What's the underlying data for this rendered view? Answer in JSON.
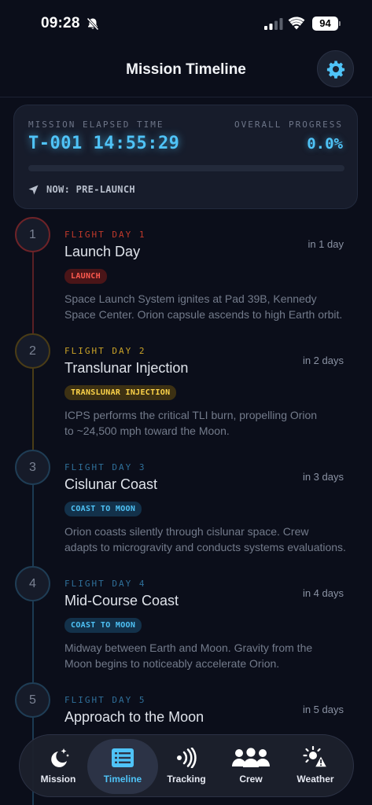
{
  "status_bar": {
    "time": "09:28",
    "battery": "94"
  },
  "header": {
    "title": "Mission Timeline",
    "settings_icon": "gear-icon"
  },
  "mission": {
    "elapsed_label": "MISSION ELAPSED TIME",
    "elapsed_value": "T-001 14:55:29",
    "progress_label": "OVERALL PROGRESS",
    "progress_value": "0.0%",
    "progress_fraction": 0.0,
    "now_text": "NOW: PRE-LAUNCH"
  },
  "events": [
    {
      "number": "1",
      "flight_day": "FLIGHT DAY 1",
      "title": "Launch Day",
      "when": "in 1 day",
      "badge": "LAUNCH",
      "desc_line1": "Space Launch System ignites at Pad 39B, Kennedy",
      "desc_line2": "Space Center. Orion capsule ascends to high Earth orbit.",
      "accent": "#c0392b",
      "badge_bg": "#4a1518",
      "badge_fg": "#ff5a4f"
    },
    {
      "number": "2",
      "flight_day": "FLIGHT DAY 2",
      "title": "Translunar Injection",
      "when": "in 2 days",
      "badge": "TRANSLUNAR INJECTION",
      "desc_line1": "ICPS performs the critical TLI burn, propelling Orion",
      "desc_line2": "to ~24,500 mph toward the Moon.",
      "accent": "#c9a227",
      "badge_bg": "#3d3113",
      "badge_fg": "#ffd54a"
    },
    {
      "number": "3",
      "flight_day": "FLIGHT DAY 3",
      "title": "Cislunar Coast",
      "when": "in 3 days",
      "badge": "COAST TO MOON",
      "desc_line1": "Orion coasts silently through cislunar space. Crew",
      "desc_line2": "adapts to microgravity and conducts systems evaluations.",
      "accent": "#2f6f99",
      "badge_bg": "#13314a",
      "badge_fg": "#4fc3f7"
    },
    {
      "number": "4",
      "flight_day": "FLIGHT DAY 4",
      "title": "Mid-Course Coast",
      "when": "in 4 days",
      "badge": "COAST TO MOON",
      "desc_line1": "Midway between Earth and Moon. Gravity from the",
      "desc_line2": "Moon begins to noticeably accelerate Orion.",
      "accent": "#2f6f99",
      "badge_bg": "#13314a",
      "badge_fg": "#4fc3f7"
    },
    {
      "number": "5",
      "flight_day": "FLIGHT DAY 5",
      "title": "Approach to the Moon",
      "when": "in 5 days",
      "badge": "",
      "desc_line1": "",
      "desc_line2": "",
      "accent": "#2f6f99",
      "badge_bg": "#13314a",
      "badge_fg": "#4fc3f7"
    }
  ],
  "tabs": [
    {
      "label": "Mission",
      "icon": "moon-stars-icon"
    },
    {
      "label": "Timeline",
      "icon": "list-icon",
      "active": true
    },
    {
      "label": "Tracking",
      "icon": "signal-waves-icon"
    },
    {
      "label": "Crew",
      "icon": "crew-icon"
    },
    {
      "label": "Weather",
      "icon": "weather-alert-icon"
    }
  ],
  "colors": {
    "accent": "#4fc3f7",
    "background": "#0b0e1a",
    "card": "#171c2b"
  }
}
